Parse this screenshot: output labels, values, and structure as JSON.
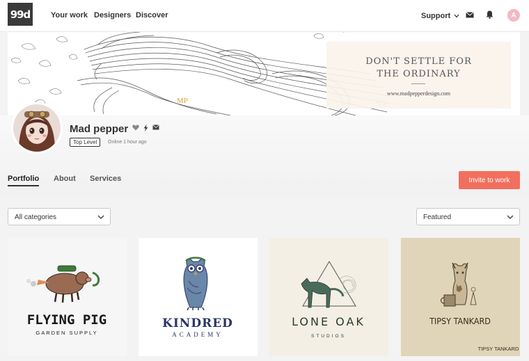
{
  "nav": {
    "logo": "99d",
    "links": [
      "Your work",
      "Designers",
      "Discover"
    ],
    "support": "Support",
    "avatar_initial": "A"
  },
  "banner": {
    "tagline_line1": "DON'T SETTLE FOR",
    "tagline_line2": "THE ORDINARY",
    "url": "www.madpepperdesign.com",
    "signature": "MP"
  },
  "profile": {
    "name": "Mad pepper",
    "level": "Top Level",
    "status": "Online 1 hour ago"
  },
  "tabs": [
    "Portfolio",
    "About",
    "Services"
  ],
  "invite_label": "Invite to work",
  "filters": {
    "category": "All categories",
    "sort": "Featured"
  },
  "portfolio": [
    {
      "title": "FLYING PIG",
      "subtitle": "GARDEN SUPPLY"
    },
    {
      "title": "KINDRED",
      "subtitle": "ACADEMY"
    },
    {
      "title": "LONE OAK",
      "subtitle": "STUDIOS"
    },
    {
      "title": "TIPSY TANKARD",
      "subtitle": "TIPSY TANKARD"
    }
  ],
  "colors": {
    "accent": "#f26f5f",
    "avatar": "#f3b9c2",
    "kindred_navy": "#2a3566"
  }
}
